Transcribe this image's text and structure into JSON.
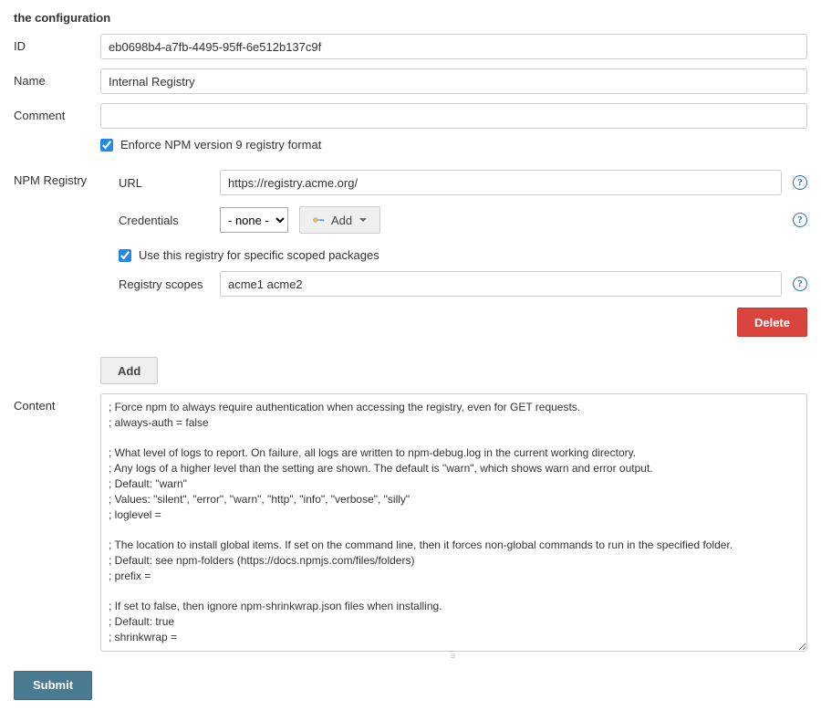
{
  "section_title": "the configuration",
  "fields": {
    "id": {
      "label": "ID",
      "value": "eb0698b4-a7fb-4495-95ff-6e512b137c9f"
    },
    "name": {
      "label": "Name",
      "value": "Internal Registry"
    },
    "comment": {
      "label": "Comment",
      "value": ""
    }
  },
  "npm_registry": {
    "label": "NPM Registry",
    "enforce_v9": {
      "label": "Enforce NPM version 9 registry format",
      "checked": true
    },
    "url": {
      "label": "URL",
      "value": "https://registry.acme.org/"
    },
    "credentials": {
      "label": "Credentials",
      "selected": "- none -",
      "add_label": "Add"
    },
    "scoped": {
      "label": "Use this registry for specific scoped packages",
      "checked": true
    },
    "scopes": {
      "label": "Registry scopes",
      "value": "acme1 acme2"
    },
    "delete_label": "Delete",
    "add_label": "Add"
  },
  "content": {
    "label": "Content",
    "value": "; Force npm to always require authentication when accessing the registry, even for GET requests.\n; always-auth = false\n\n; What level of logs to report. On failure, all logs are written to npm-debug.log in the current working directory.\n; Any logs of a higher level than the setting are shown. The default is \"warn\", which shows warn and error output.\n; Default: \"warn\"\n; Values: \"silent\", \"error\", \"warn\", \"http\", \"info\", \"verbose\", \"silly\"\n; loglevel =\n\n; The location to install global items. If set on the command line, then it forces non-global commands to run in the specified folder.\n; Default: see npm-folders (https://docs.npmjs.com/files/folders)\n; prefix =\n\n; If set to false, then ignore npm-shrinkwrap.json files when installing.\n; Default: true\n; shrinkwrap ="
  },
  "submit_label": "Submit"
}
